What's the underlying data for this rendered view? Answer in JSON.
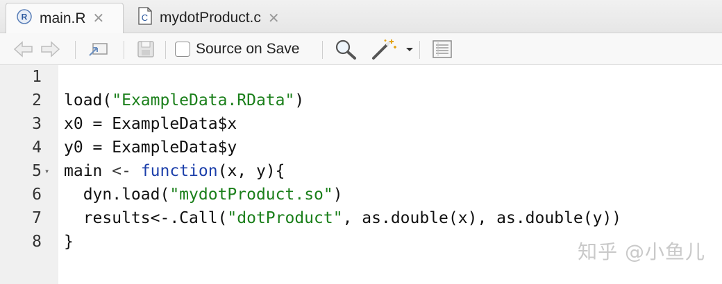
{
  "tabs": [
    {
      "label": "main.R",
      "icon": "r-file-icon",
      "active": true
    },
    {
      "label": "mydotProduct.c",
      "icon": "c-file-icon",
      "active": false
    }
  ],
  "toolbar": {
    "source_on_save": "Source on Save",
    "icons": [
      "back-arrow-icon",
      "forward-arrow-icon",
      "show-in-window-icon",
      "save-icon",
      "search-icon",
      "magic-wand-icon",
      "dropdown-icon",
      "outline-icon"
    ]
  },
  "editor": {
    "lines": [
      {
        "n": "1",
        "text": ""
      },
      {
        "n": "2",
        "parts": [
          [
            "load(",
            "plain"
          ],
          [
            "\"ExampleData.RData\"",
            "str"
          ],
          [
            ")",
            "plain"
          ]
        ]
      },
      {
        "n": "3",
        "parts": [
          [
            "x0 = ExampleData$x",
            "plain"
          ]
        ]
      },
      {
        "n": "4",
        "parts": [
          [
            "y0 = ExampleData$y",
            "plain"
          ]
        ]
      },
      {
        "n": "5",
        "fold": true,
        "parts": [
          [
            "main ",
            "plain"
          ],
          [
            "<-",
            "op"
          ],
          [
            " ",
            "plain"
          ],
          [
            "function",
            "kw"
          ],
          [
            "(x, y){",
            "plain"
          ]
        ]
      },
      {
        "n": "6",
        "parts": [
          [
            "  dyn.load(",
            "plain"
          ],
          [
            "\"mydotProduct.so\"",
            "str"
          ],
          [
            ")",
            "plain"
          ]
        ]
      },
      {
        "n": "7",
        "parts": [
          [
            "  results<-.Call(",
            "plain"
          ],
          [
            "\"dotProduct\"",
            "str"
          ],
          [
            ", as.double(x), as.double(y))",
            "plain"
          ]
        ]
      },
      {
        "n": "8",
        "parts": [
          [
            "}",
            "plain"
          ]
        ]
      }
    ]
  },
  "watermark": "知乎 @小鱼儿",
  "colors": {
    "string": "#1a7f1a",
    "keyword": "#1c3faa",
    "gutter": "#f0f0f0"
  }
}
